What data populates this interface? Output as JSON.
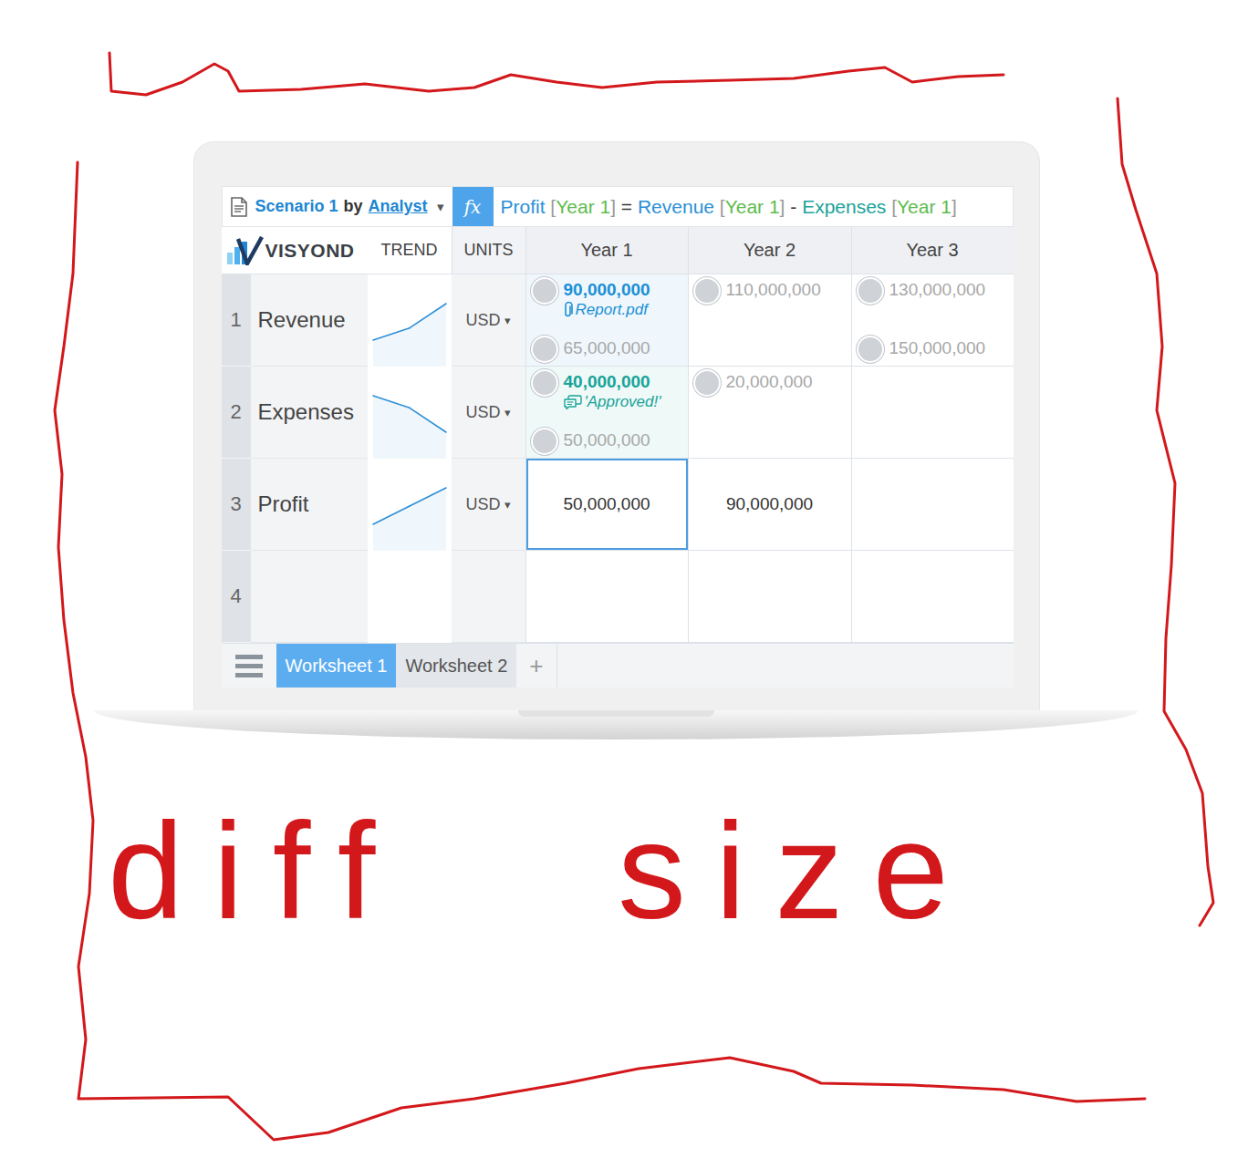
{
  "header": {
    "scenario": "Scenario 1",
    "by": "by",
    "author": "Analyst",
    "caret": "▾",
    "fx": "fx",
    "formula": [
      {
        "text": "Profit",
        "color": "#2a8fd6"
      },
      {
        "text": " [",
        "color": "#9a9a9a"
      },
      {
        "text": "Year 1",
        "color": "#5cbc4c"
      },
      {
        "text": "]",
        "color": "#9a9a9a"
      },
      {
        "text": " = ",
        "color": "#333333"
      },
      {
        "text": "Revenue",
        "color": "#2a8fd6"
      },
      {
        "text": " [",
        "color": "#9a9a9a"
      },
      {
        "text": "Year 1",
        "color": "#5cbc4c"
      },
      {
        "text": "]",
        "color": "#9a9a9a"
      },
      {
        "text": " - ",
        "color": "#333333"
      },
      {
        "text": "Expenses",
        "color": "#1ba39a"
      },
      {
        "text": " [",
        "color": "#9a9a9a"
      },
      {
        "text": "Year 1",
        "color": "#5cbc4c"
      },
      {
        "text": "]",
        "color": "#9a9a9a"
      }
    ]
  },
  "logo": {
    "text": "VISYOND"
  },
  "columns": [
    "TREND",
    "UNITS",
    "Year 1",
    "Year 2",
    "Year 3"
  ],
  "rows": [
    {
      "number": "1",
      "label": "Revenue",
      "unit": "USD",
      "caret": "▾",
      "kind": "inputs",
      "trend": [
        90,
        110,
        150
      ],
      "cells": [
        {
          "entries": [
            {
              "value": "90,000,000",
              "accepted": true,
              "color": "#1a8fd6",
              "note": {
                "kind": "attachment",
                "text": "Report.pdf"
              }
            },
            {
              "value": "65,000,000",
              "accepted": false,
              "color": "#a8a8a8"
            }
          ]
        },
        {
          "entries": [
            {
              "value": "110,000,000",
              "accepted": false,
              "color": "#a8a8a8"
            }
          ]
        },
        {
          "entries": [
            {
              "value": "130,000,000",
              "accepted": false,
              "color": "#a8a8a8"
            },
            {
              "value": "150,000,000",
              "accepted": false,
              "color": "#a8a8a8"
            }
          ]
        }
      ]
    },
    {
      "number": "2",
      "label": "Expenses",
      "unit": "USD",
      "caret": "▾",
      "kind": "inputs",
      "trend": [
        50,
        40,
        20
      ],
      "cells": [
        {
          "entries": [
            {
              "value": "40,000,000",
              "accepted": true,
              "color": "#17a398",
              "note": {
                "kind": "comment",
                "text": "'Approved!'"
              }
            },
            {
              "value": "50,000,000",
              "accepted": false,
              "color": "#a8a8a8"
            }
          ]
        },
        {
          "entries": [
            {
              "value": "20,000,000",
              "accepted": false,
              "color": "#a8a8a8"
            }
          ]
        }
      ]
    },
    {
      "number": "3",
      "label": "Profit",
      "unit": "USD",
      "caret": "▾",
      "kind": "formula",
      "trend": [
        50,
        70,
        90
      ],
      "cells": [
        {
          "value": "50,000,000",
          "selected": true
        },
        {
          "value": "90,000,000",
          "selected": false
        }
      ]
    },
    {
      "number": "4",
      "kind": "empty",
      "cells": []
    }
  ],
  "tabs": [
    {
      "label": "Worksheet 1",
      "selected": true
    },
    {
      "label": "Worksheet 2",
      "selected": false
    }
  ],
  "addTab": "+",
  "annotation": "diff size"
}
